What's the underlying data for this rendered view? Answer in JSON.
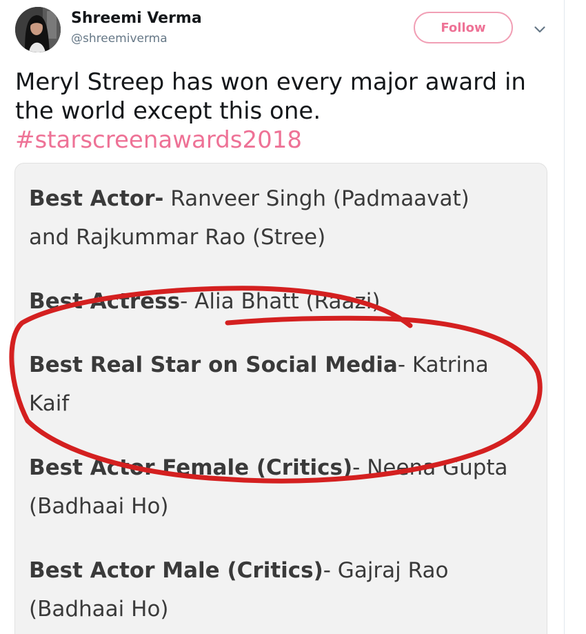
{
  "user": {
    "name": "Shreemi Verma",
    "handle": "@shreemiverma"
  },
  "follow_label": "Follow",
  "tweet": {
    "line1": "Meryl Streep has won every major award in",
    "line2": "the world except this one.",
    "hashtag": "#starscreenawards2018"
  },
  "awards": [
    {
      "category": "Best Actor-",
      "line1_rest": " Ranveer Singh (Padmaavat)",
      "line2": "and Rajkummar Rao (Stree)"
    },
    {
      "category": "Best Actress",
      "line1_rest": "- Alia Bhatt (Raazi)",
      "line2": ""
    },
    {
      "category": "Best Real Star on Social Media",
      "line1_rest": "- Katrina",
      "line2": "Kaif"
    },
    {
      "category": "Best Actor Female (Critics)",
      "line1_rest": "- Neena Gupta",
      "line2": "(Badhaai Ho)"
    },
    {
      "category": "Best Actor Male (Critics)",
      "line1_rest": "- Gajraj Rao",
      "line2": "(Badhaai Ho)"
    }
  ],
  "colors": {
    "accent": "#ee7296",
    "annotation": "#d42020"
  },
  "icons": {
    "menu": "chevron-down-icon"
  }
}
